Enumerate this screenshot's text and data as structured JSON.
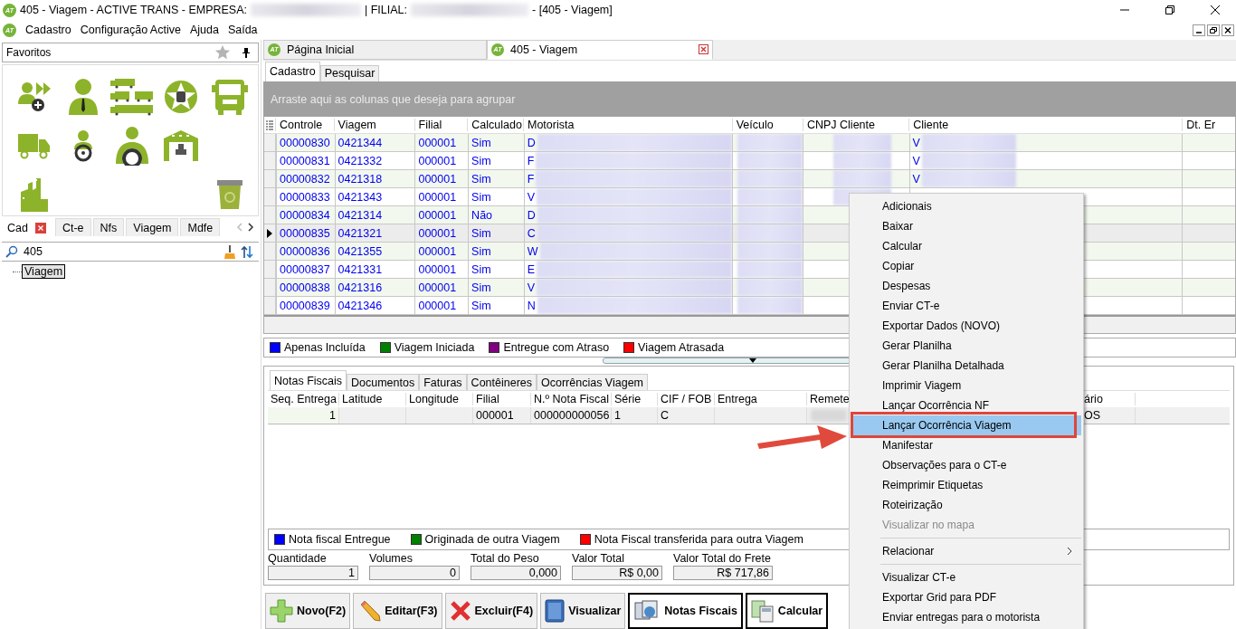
{
  "window": {
    "logo": "AT",
    "title_parts": [
      "405 - Viagem - ACTIVE TRANS - EMPRESA:",
      "| FILIAL:",
      "- [405 - Viagem]"
    ]
  },
  "menubar": {
    "logo": "AT",
    "items": [
      "Cadastro",
      "Configuração Active",
      "Ajuda",
      "Saída"
    ]
  },
  "sidebar": {
    "favorites_title": "Favoritos",
    "tabs": [
      {
        "label": "Cad",
        "selected": true
      },
      {
        "label": "Ct-e",
        "selected": false
      },
      {
        "label": "Nfs",
        "selected": false
      },
      {
        "label": "Viagem",
        "selected": false
      },
      {
        "label": "Mdfe",
        "selected": false
      }
    ],
    "search": {
      "value": "405"
    },
    "tree": [
      {
        "label": "Viagem",
        "selected": true
      }
    ]
  },
  "doc_tabs": [
    {
      "logo": "AT",
      "label": "Página Inicial",
      "selected": false
    },
    {
      "logo": "AT",
      "label": "405 - Viagem",
      "selected": true
    }
  ],
  "sub_tabs": [
    {
      "label": "Cadastro",
      "selected": true
    },
    {
      "label": "Pesquisar",
      "selected": false
    }
  ],
  "group_bar": "Arraste aqui as colunas que deseja para agrupar",
  "table": {
    "columns": [
      "Controle",
      "Viagem",
      "Filial",
      "Calculado",
      "Motorista",
      "Veículo",
      "CNPJ Cliente",
      "Cliente",
      "Dt. Er"
    ],
    "rows": [
      {
        "controle": "00000830",
        "viagem": "0421344",
        "filial": "000001",
        "calculado": "Sim",
        "motorista": "D",
        "cliente": "V",
        "selected": false
      },
      {
        "controle": "00000831",
        "viagem": "0421332",
        "filial": "000001",
        "calculado": "Sim",
        "motorista": "F",
        "cliente": "V",
        "selected": false
      },
      {
        "controle": "00000832",
        "viagem": "0421318",
        "filial": "000001",
        "calculado": "Sim",
        "motorista": "F",
        "cliente": "V",
        "selected": false
      },
      {
        "controle": "00000833",
        "viagem": "0421343",
        "filial": "000001",
        "calculado": "Sim",
        "motorista": "V",
        "selected": false
      },
      {
        "controle": "00000834",
        "viagem": "0421314",
        "filial": "000001",
        "calculado": "Não",
        "motorista": "D",
        "selected": false
      },
      {
        "controle": "00000835",
        "viagem": "0421321",
        "filial": "000001",
        "calculado": "Sim",
        "motorista": "C",
        "selected": true
      },
      {
        "controle": "00000836",
        "viagem": "0421355",
        "filial": "000001",
        "calculado": "Sim",
        "motorista": "W",
        "selected": false
      },
      {
        "controle": "00000837",
        "viagem": "0421331",
        "filial": "000001",
        "calculado": "Sim",
        "motorista": "E",
        "selected": false
      },
      {
        "controle": "00000838",
        "viagem": "0421316",
        "filial": "000001",
        "calculado": "Sim",
        "motorista": "V",
        "selected": false
      },
      {
        "controle": "00000839",
        "viagem": "0421346",
        "filial": "000001",
        "calculado": "Sim",
        "motorista": "N",
        "selected": false
      }
    ]
  },
  "legend": [
    {
      "label": "Apenas Incluída",
      "color": "#0000ff"
    },
    {
      "label": "Viagem Iniciada",
      "color": "#008000"
    },
    {
      "label": "Entregue com Atraso",
      "color": "#800080"
    },
    {
      "label": "Viagem Atrasada",
      "color": "#ff0000"
    }
  ],
  "detail_tabs": [
    {
      "label": "Notas Fiscais",
      "selected": true
    },
    {
      "label": "Documentos",
      "selected": false
    },
    {
      "label": "Faturas",
      "selected": false
    },
    {
      "label": "Contêineres",
      "selected": false
    },
    {
      "label": "Ocorrências Viagem",
      "selected": false
    }
  ],
  "detail_table": {
    "columns": [
      "Seq. Entrega",
      "Latitude",
      "Longitude",
      "Filial",
      "N.º Nota Fiscal",
      "Série",
      "CIF / FOB",
      "Entrega",
      "Remete",
      "ário"
    ],
    "rows": [
      {
        "cells": [
          "1",
          "",
          "",
          "000001",
          "000000000056",
          "1",
          "C",
          "",
          "",
          "OS"
        ]
      }
    ]
  },
  "detail_legend": [
    {
      "label": "Nota fiscal Entregue",
      "color": "#0000ff"
    },
    {
      "label": "Originada de outra Viagem",
      "color": "#008000"
    },
    {
      "label": "Nota Fiscal transferida para outra Viagem",
      "color": "#ff0000"
    }
  ],
  "totals": [
    {
      "label": "Quantidade",
      "value": "1"
    },
    {
      "label": "Volumes",
      "value": "0"
    },
    {
      "label": "Total do Peso",
      "value": "0,000"
    },
    {
      "label": "Valor Total",
      "value": "R$ 0,00"
    },
    {
      "label": "Valor Total do Frete",
      "value": "R$ 717,86"
    }
  ],
  "toolbar": [
    {
      "label": "Novo(F2)",
      "active": false
    },
    {
      "label": "Editar(F3)",
      "active": false
    },
    {
      "label": "Excluir(F4)",
      "active": false
    },
    {
      "label": "Visualizar",
      "active": false
    },
    {
      "label": "Notas Fiscais",
      "active": true
    },
    {
      "label": "Calcular",
      "active": true
    }
  ],
  "context_menu": {
    "sections": [
      [
        {
          "label": "Adicionais",
          "kind": "item",
          "disabled": false,
          "selected": false
        },
        {
          "label": "Baixar",
          "kind": "item",
          "disabled": false,
          "selected": false
        },
        {
          "label": "Calcular",
          "kind": "item",
          "disabled": false,
          "selected": false
        },
        {
          "label": "Copiar",
          "kind": "item",
          "disabled": false,
          "selected": false
        },
        {
          "label": "Despesas",
          "kind": "item",
          "disabled": false,
          "selected": false
        },
        {
          "label": "Enviar CT-e",
          "kind": "item",
          "disabled": false,
          "selected": false
        },
        {
          "label": "Exportar Dados (NOVO)",
          "kind": "item",
          "disabled": false,
          "selected": false
        },
        {
          "label": "Gerar Planilha",
          "kind": "item",
          "disabled": false,
          "selected": false
        },
        {
          "label": "Gerar Planilha Detalhada",
          "kind": "item",
          "disabled": false,
          "selected": false
        },
        {
          "label": "Imprimir Viagem",
          "kind": "item",
          "disabled": false,
          "selected": false
        },
        {
          "label": "Lançar Ocorrência NF",
          "kind": "item",
          "disabled": false,
          "selected": false
        },
        {
          "label": "Lançar Ocorrência Viagem",
          "kind": "item",
          "disabled": false,
          "selected": true
        },
        {
          "label": "Manifestar",
          "kind": "item",
          "disabled": false,
          "selected": false
        },
        {
          "label": "Observações para o CT-e",
          "kind": "item",
          "disabled": false,
          "selected": false
        },
        {
          "label": "Reimprimir Etiquetas",
          "kind": "item",
          "disabled": false,
          "selected": false
        },
        {
          "label": "Roteirização",
          "kind": "item",
          "disabled": false,
          "selected": false
        },
        {
          "label": "Visualizar no mapa",
          "kind": "item",
          "disabled": true,
          "selected": false
        }
      ],
      [
        {
          "label": "Relacionar",
          "kind": "submenu",
          "disabled": false,
          "selected": false
        }
      ],
      [
        {
          "label": "Visualizar CT-e",
          "kind": "item",
          "disabled": false,
          "selected": false
        },
        {
          "label": "Exportar Grid para PDF",
          "kind": "item",
          "disabled": false,
          "selected": false
        },
        {
          "label": "Enviar entregas para o motorista",
          "kind": "item",
          "disabled": false,
          "selected": false
        }
      ]
    ]
  }
}
